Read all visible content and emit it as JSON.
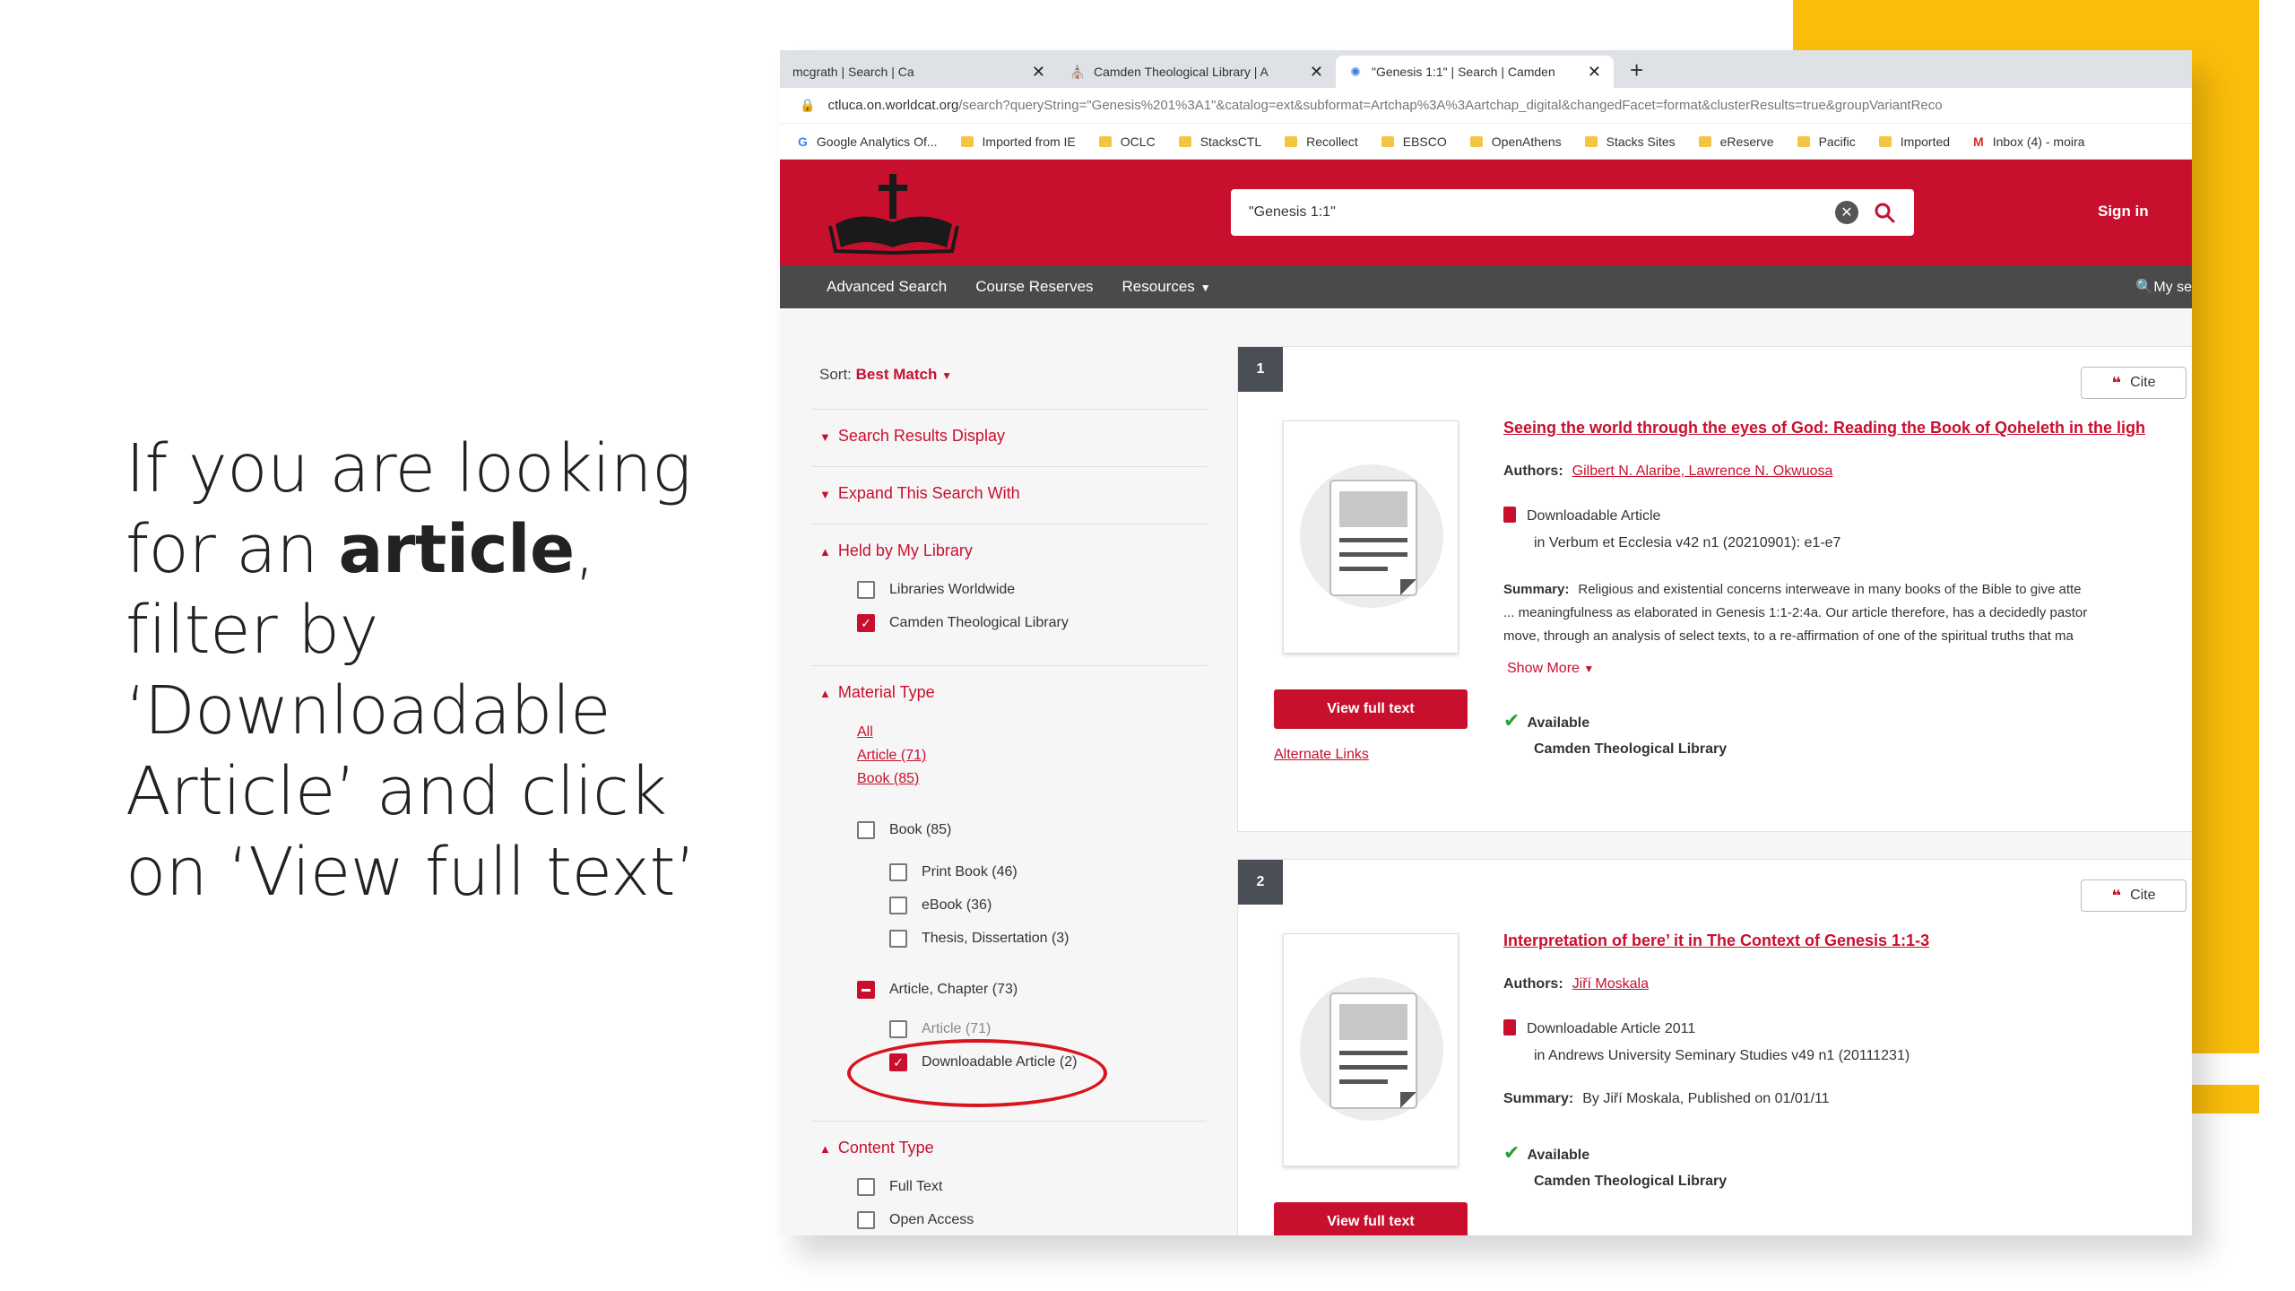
{
  "instruction": {
    "line1": "If you are looking",
    "line2_pre": "for an ",
    "line2_bold": "article",
    "line2_post": ",",
    "line3": "filter by",
    "line4": "‘Downloadable",
    "line5": "Article’ and click",
    "line6": "on ‘View full text’"
  },
  "tabs": [
    {
      "title": "mcgrath | Search | Ca",
      "icon": "page-icon",
      "active": false
    },
    {
      "title": "Camden Theological Library | A",
      "icon": "library-icon",
      "active": false
    },
    {
      "title": "\"Genesis 1:1\" | Search | Camden",
      "icon": "worldcat-icon",
      "active": true
    }
  ],
  "address": {
    "host": "ctluca.on.worldcat.org",
    "path": "/search?queryString=\"Genesis%201%3A1\"&catalog=ext&subformat=Artchap%3A%3Aartchap_digital&changedFacet=format&clusterResults=true&groupVariantReco"
  },
  "bookmarks": [
    {
      "label": "Google Analytics Of...",
      "icon": "google-icon"
    },
    {
      "label": "Imported from IE",
      "icon": "folder-icon"
    },
    {
      "label": "OCLC",
      "icon": "folder-icon"
    },
    {
      "label": "StacksCTL",
      "icon": "folder-icon"
    },
    {
      "label": "Recollect",
      "icon": "folder-icon"
    },
    {
      "label": "EBSCO",
      "icon": "folder-icon"
    },
    {
      "label": "OpenAthens",
      "icon": "folder-icon"
    },
    {
      "label": "Stacks Sites",
      "icon": "folder-icon"
    },
    {
      "label": "eReserve",
      "icon": "folder-icon"
    },
    {
      "label": "Pacific",
      "icon": "folder-icon"
    },
    {
      "label": "Imported",
      "icon": "folder-icon"
    },
    {
      "label": "Inbox (4) - moira",
      "icon": "gmail-icon"
    }
  ],
  "header": {
    "search_value": "\"Genesis 1:1\"",
    "sign_in": "Sign in"
  },
  "nav": {
    "advanced_search": "Advanced Search",
    "course_reserves": "Course Reserves",
    "resources": "Resources",
    "my_search": "My se"
  },
  "sidebar": {
    "sort_label": "Sort:",
    "sort_value": "Best Match",
    "search_results_display": "Search Results Display",
    "expand_search": "Expand This Search With",
    "held_by": "Held by My Library",
    "libraries_worldwide": "Libraries Worldwide",
    "camden_library": "Camden Theological Library",
    "material_type": "Material Type",
    "all": "All",
    "article_71": "Article (71)",
    "book_85": "Book (85)",
    "cb_book": "Book (85)",
    "cb_print_book": "Print Book (46)",
    "cb_ebook": "eBook (36)",
    "cb_thesis": "Thesis, Dissertation (3)",
    "cb_article_chapter": "Article, Chapter (73)",
    "cb_article": "Article (71)",
    "cb_downloadable": "Downloadable Article (2)",
    "content_type": "Content Type",
    "full_text": "Full Text",
    "open_access": "Open Access"
  },
  "results": [
    {
      "number": "1",
      "cite": "Cite",
      "title": "Seeing the world through the eyes of God: Reading the Book of Qoheleth in the ligh",
      "authors_label": "Authors:",
      "authors": "Gilbert N. Alaribe, Lawrence N. Okwuosa",
      "format": "Downloadable Article",
      "source": "in Verbum et Ecclesia v42 n1 (20210901): e1-e7",
      "summary_label": "Summary:",
      "summary1": "Religious and existential concerns interweave in many books of the Bible to give atte",
      "summary2": "... meaningfulness as elaborated in Genesis 1:1-2:4a. Our article therefore, has a decidedly pastor",
      "summary3": "move, through an analysis of select texts, to a re-affirmation of one of the spiritual truths that ma",
      "show_more": "Show More",
      "view_full_text": "View full text",
      "alternate_links": "Alternate Links",
      "available": "Available",
      "library": "Camden Theological Library"
    },
    {
      "number": "2",
      "cite": "Cite",
      "title": "Interpretation of bere’ it in The Context of Genesis 1:1-3",
      "authors_label": "Authors:",
      "authors": "Jiří Moskala",
      "format": "Downloadable Article 2011",
      "source": "in Andrews University Seminary Studies v49 n1 (20111231)",
      "summary_label": "Summary:",
      "summary1": "By Jiří Moskala, Published on 01/01/11",
      "available": "Available",
      "library": "Camden Theological Library",
      "view_full_text": "View full text"
    }
  ],
  "colors": {
    "brand_red": "#c8102e",
    "nav_gray": "#4a4a4a",
    "accent_yellow": "#fbbd0b",
    "ring_red": "#d8141f"
  }
}
